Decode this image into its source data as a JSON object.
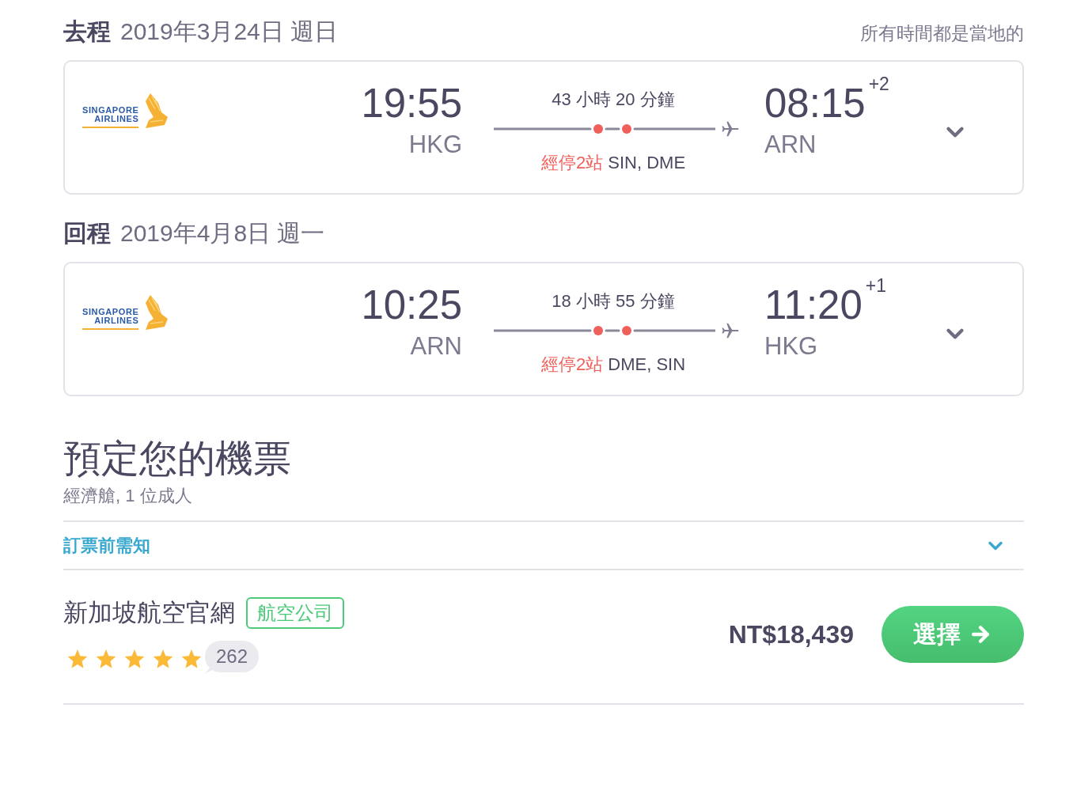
{
  "legs": [
    {
      "label": "去程",
      "date": "2019年3月24日 週日",
      "note": "所有時間都是當地的",
      "airline_logo": [
        "SINGAPORE",
        "AIRLINES"
      ],
      "departure": {
        "time": "19:55",
        "airport": "HKG"
      },
      "duration": "43 小時 20 分鐘",
      "stops": {
        "label": "經停2站",
        "airports": "SIN, DME"
      },
      "arrival": {
        "time": "08:15",
        "day_offset": "+2",
        "airport": "ARN"
      }
    },
    {
      "label": "回程",
      "date": "2019年4月8日 週一",
      "airline_logo": [
        "SINGAPORE",
        "AIRLINES"
      ],
      "departure": {
        "time": "10:25",
        "airport": "ARN"
      },
      "duration": "18 小時 55 分鐘",
      "stops": {
        "label": "經停2站",
        "airports": "DME, SIN"
      },
      "arrival": {
        "time": "11:20",
        "day_offset": "+1",
        "airport": "HKG"
      }
    }
  ],
  "booking": {
    "title": "預定您的機票",
    "subtitle": "經濟艙, 1 位成人",
    "notice_link": "訂票前需知",
    "offers": [
      {
        "provider": "新加坡航空官網",
        "badge": "航空公司",
        "stars": 5,
        "review_count": "262",
        "price": "NT$18,439",
        "button": "選擇"
      }
    ]
  }
}
